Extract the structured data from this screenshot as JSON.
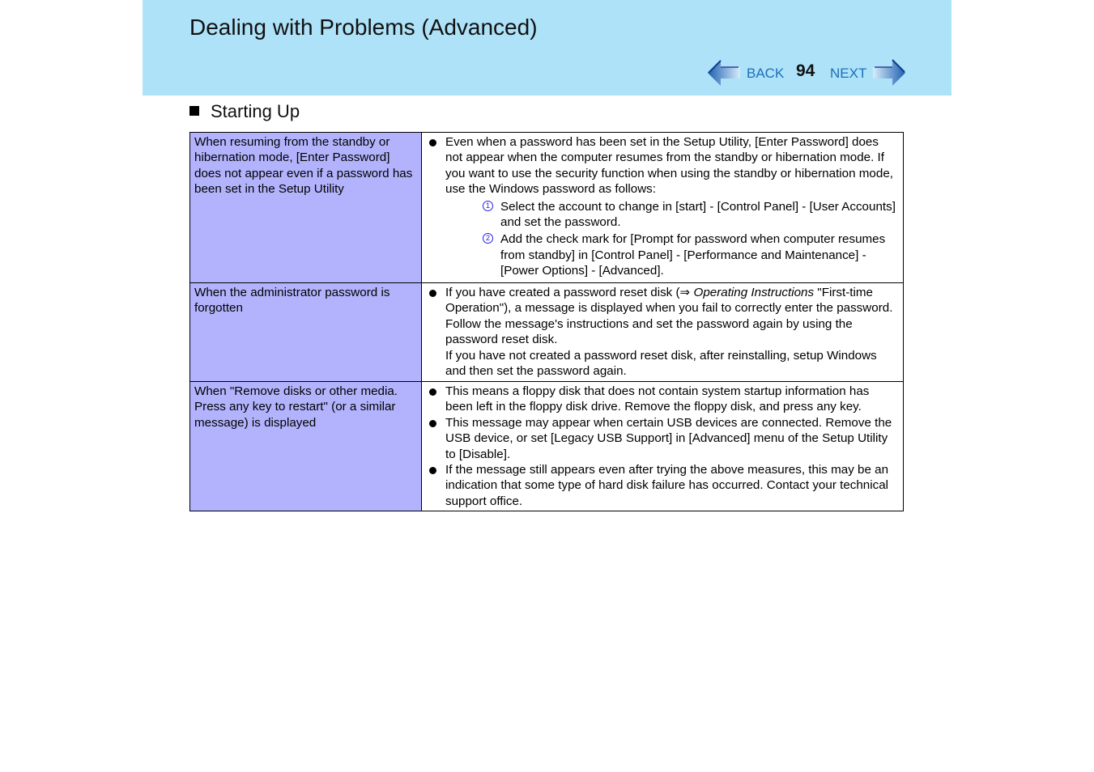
{
  "header": {
    "title": "Dealing with Problems (Advanced)",
    "nav": {
      "back_label": "BACK",
      "page_number": "94",
      "next_label": "NEXT",
      "back_icon": "left-arrow-icon",
      "next_icon": "right-arrow-icon"
    }
  },
  "section": {
    "bullet_icon": "square-bullet-icon",
    "title": "Starting Up"
  },
  "colors": {
    "header_bg": "#aee2f8",
    "condition_cell_bg": "#b3b3fd",
    "nav_link": "#1c6fb8",
    "step_number": "#2222dd"
  },
  "table": {
    "rows": [
      {
        "condition": "When resuming from the standby or hibernation mode, [Enter Password] does not appear even if a password has been set in the Setup Utility",
        "bullets": [
          {
            "text": "Even when a password has been set in the Setup Utility, [Enter Password] does not appear when the computer resumes from the standby or hibernation mode. If you want to use the security function when using the standby or hibernation mode, use the Windows password as follows:",
            "steps": [
              {
                "num": "1",
                "text": "Select the account to change in [start] - [Control Panel] - [User Accounts] and set the password."
              },
              {
                "num": "2",
                "text": "Add the check mark for [Prompt for password when computer resumes from standby] in [Control Panel] - [Performance and Maintenance] - [Power Options] - [Advanced]."
              }
            ]
          }
        ]
      },
      {
        "condition": "When the administrator password is forgotten",
        "bullets": [
          {
            "text_before": "If you have created a password reset disk (⇒ ",
            "reference": "Operating Instructions",
            "text_after": " \"First-time Operation\"), a message is displayed when you fail to correctly enter the password.  Follow the message's instructions and set the password again by using the password reset disk.",
            "text_extra": "If you have not created a password reset disk, after reinstalling, setup Windows and then set the password again."
          }
        ]
      },
      {
        "condition": "When \"Remove disks or other media. Press any key to restart\" (or a similar message) is displayed",
        "bullets": [
          {
            "text": "This means a floppy disk that does not contain system startup information has been left in the floppy disk drive. Remove the floppy disk, and press any key."
          },
          {
            "text": "This message may appear when certain USB devices are connected. Remove the USB device, or set [Legacy USB Support] in [Advanced] menu of the Setup Utility to [Disable]."
          },
          {
            "text": "If the message still appears even after trying the above measures, this may be an indication that some type of hard disk failure has occurred. Contact your technical support office."
          }
        ]
      }
    ]
  }
}
